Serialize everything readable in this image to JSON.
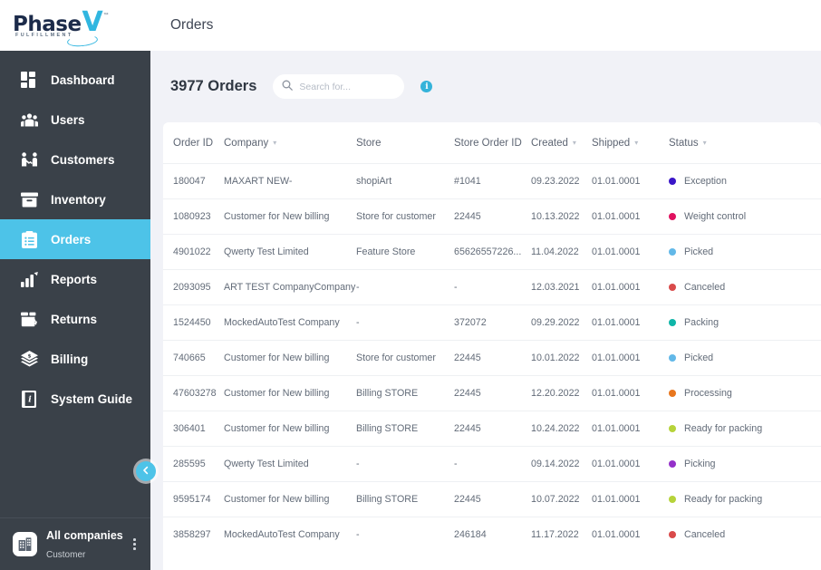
{
  "brand": {
    "name_main": "Phase",
    "name_accent": "V",
    "tagline": "FULFILLMENT",
    "tm": "™",
    "color_dark": "#1c2b4a",
    "color_accent": "#30b6e0"
  },
  "sidebar": {
    "background": "#3a4149",
    "active_color": "#4dc3e8",
    "items": [
      {
        "label": "Dashboard",
        "icon": "dashboard-icon",
        "active": false
      },
      {
        "label": "Users",
        "icon": "users-icon",
        "active": false
      },
      {
        "label": "Customers",
        "icon": "customers-icon",
        "active": false
      },
      {
        "label": "Inventory",
        "icon": "inventory-icon",
        "active": false
      },
      {
        "label": "Orders",
        "icon": "orders-icon",
        "active": true
      },
      {
        "label": "Reports",
        "icon": "reports-icon",
        "active": false
      },
      {
        "label": "Returns",
        "icon": "returns-icon",
        "active": false
      },
      {
        "label": "Billing",
        "icon": "billing-icon",
        "active": false
      },
      {
        "label": "System Guide",
        "icon": "guide-icon",
        "active": false
      }
    ],
    "company": {
      "name": "All companies",
      "role": "Customer",
      "icon": "building-icon",
      "menu_icon": "kebab-menu-icon"
    },
    "collapse_icon": "chevron-left-icon"
  },
  "header": {
    "title": "Orders"
  },
  "toolbar": {
    "count_label": "3977 Orders",
    "search_placeholder": "Search for...",
    "search_value": "",
    "search_icon": "search-icon",
    "info_icon": "info-icon",
    "info_glyph": "i"
  },
  "table": {
    "columns": [
      {
        "key": "order_id",
        "label": "Order ID",
        "sortable": false
      },
      {
        "key": "company",
        "label": "Company",
        "sortable": true
      },
      {
        "key": "store",
        "label": "Store",
        "sortable": false
      },
      {
        "key": "store_order_id",
        "label": "Store Order ID",
        "sortable": false
      },
      {
        "key": "created",
        "label": "Created",
        "sortable": true
      },
      {
        "key": "shipped",
        "label": "Shipped",
        "sortable": true
      },
      {
        "key": "status",
        "label": "Status",
        "sortable": true
      }
    ],
    "sort_caret": "▾",
    "rows": [
      {
        "order_id": "180047",
        "company": "MAXART NEW-",
        "store": "shopiArt",
        "store_order_id": "#1041",
        "created": "09.23.2022",
        "shipped": "01.01.0001",
        "status": "Exception",
        "status_color": "#3a16c8"
      },
      {
        "order_id": "1080923",
        "company": "Customer for New billing",
        "store": "Store for customer",
        "store_order_id": "22445",
        "created": "10.13.2022",
        "shipped": "01.01.0001",
        "status": "Weight control",
        "status_color": "#e0115f"
      },
      {
        "order_id": "4901022",
        "company": "Qwerty Test Limited",
        "store": "Feature Store",
        "store_order_id": "65626557226...",
        "created": "11.04.2022",
        "shipped": "01.01.0001",
        "status": "Picked",
        "status_color": "#62b8e8"
      },
      {
        "order_id": "2093095",
        "company": "ART TEST CompanyCompany",
        "store": "-",
        "store_order_id": "-",
        "created": "12.03.2021",
        "shipped": "01.01.0001",
        "status": "Canceled",
        "status_color": "#d94a4a"
      },
      {
        "order_id": "1524450",
        "company": "MockedAutoTest Company",
        "store": "-",
        "store_order_id": "372072",
        "created": "09.29.2022",
        "shipped": "01.01.0001",
        "status": "Packing",
        "status_color": "#0fb5a8"
      },
      {
        "order_id": "740665",
        "company": "Customer for New billing",
        "store": "Store for customer",
        "store_order_id": "22445",
        "created": "10.01.2022",
        "shipped": "01.01.0001",
        "status": "Picked",
        "status_color": "#62b8e8"
      },
      {
        "order_id": "47603278",
        "company": "Customer for New billing",
        "store": "Billing STORE",
        "store_order_id": "22445",
        "created": "12.20.2022",
        "shipped": "01.01.0001",
        "status": "Processing",
        "status_color": "#e8761d"
      },
      {
        "order_id": "306401",
        "company": "Customer for New billing",
        "store": "Billing STORE",
        "store_order_id": "22445",
        "created": "10.24.2022",
        "shipped": "01.01.0001",
        "status": "Ready for packing",
        "status_color": "#b6d33a"
      },
      {
        "order_id": "285595",
        "company": "Qwerty Test Limited",
        "store": "-",
        "store_order_id": "-",
        "created": "09.14.2022",
        "shipped": "01.01.0001",
        "status": "Picking",
        "status_color": "#9431c9"
      },
      {
        "order_id": "9595174",
        "company": "Customer for New billing",
        "store": "Billing STORE",
        "store_order_id": "22445",
        "created": "10.07.2022",
        "shipped": "01.01.0001",
        "status": "Ready for packing",
        "status_color": "#b6d33a"
      },
      {
        "order_id": "3858297",
        "company": "MockedAutoTest Company",
        "store": "-",
        "store_order_id": "246184",
        "created": "11.17.2022",
        "shipped": "01.01.0001",
        "status": "Canceled",
        "status_color": "#d94a4a"
      }
    ]
  }
}
